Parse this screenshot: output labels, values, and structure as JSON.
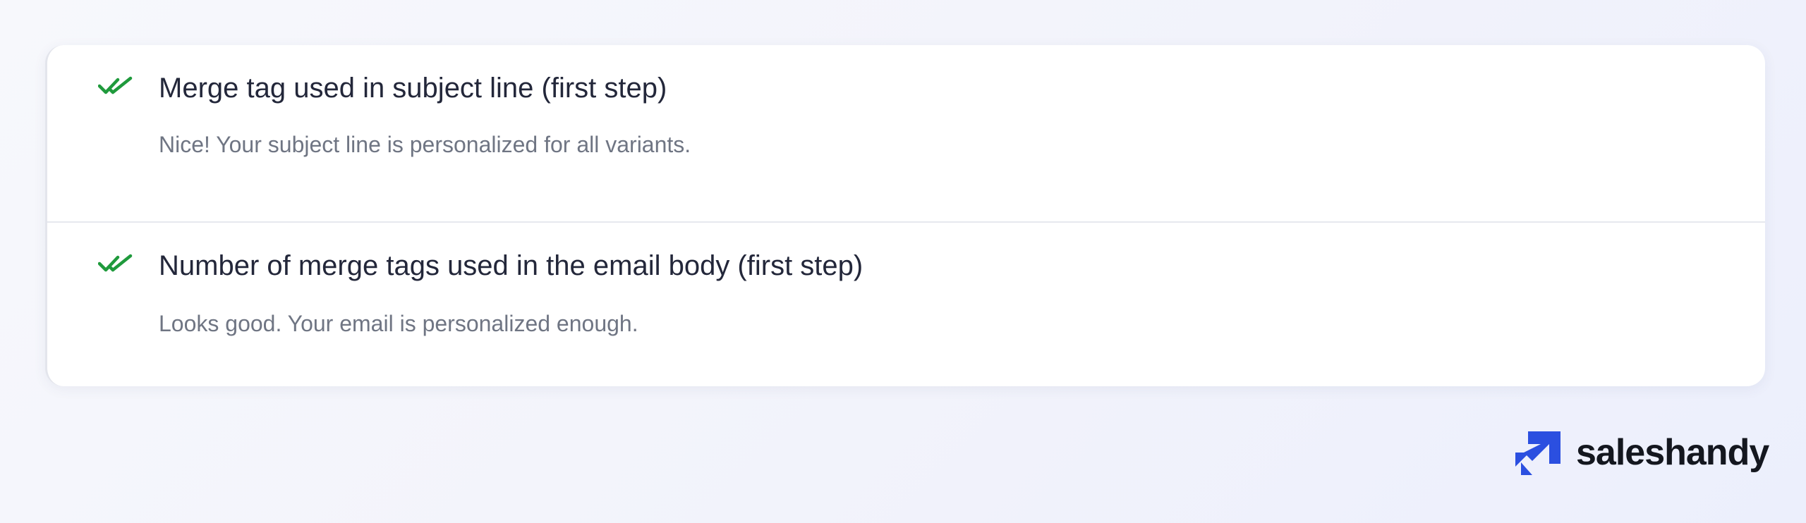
{
  "checks": [
    {
      "title": "Merge tag used in subject line (first step)",
      "description": "Nice! Your subject line is personalized for all variants.",
      "status_icon": "double-check-icon"
    },
    {
      "title": "Number of merge tags used in the email body (first step)",
      "description": "Looks good. Your email is personalized enough.",
      "status_icon": "double-check-icon"
    }
  ],
  "brand": {
    "name": "saleshandy",
    "logo_icon": "saleshandy-logo-icon"
  },
  "colors": {
    "check_green": "#1f9a3c",
    "title_text": "#23273a",
    "description_text": "#6f7583",
    "brand_blue": "#2b4fe0"
  }
}
